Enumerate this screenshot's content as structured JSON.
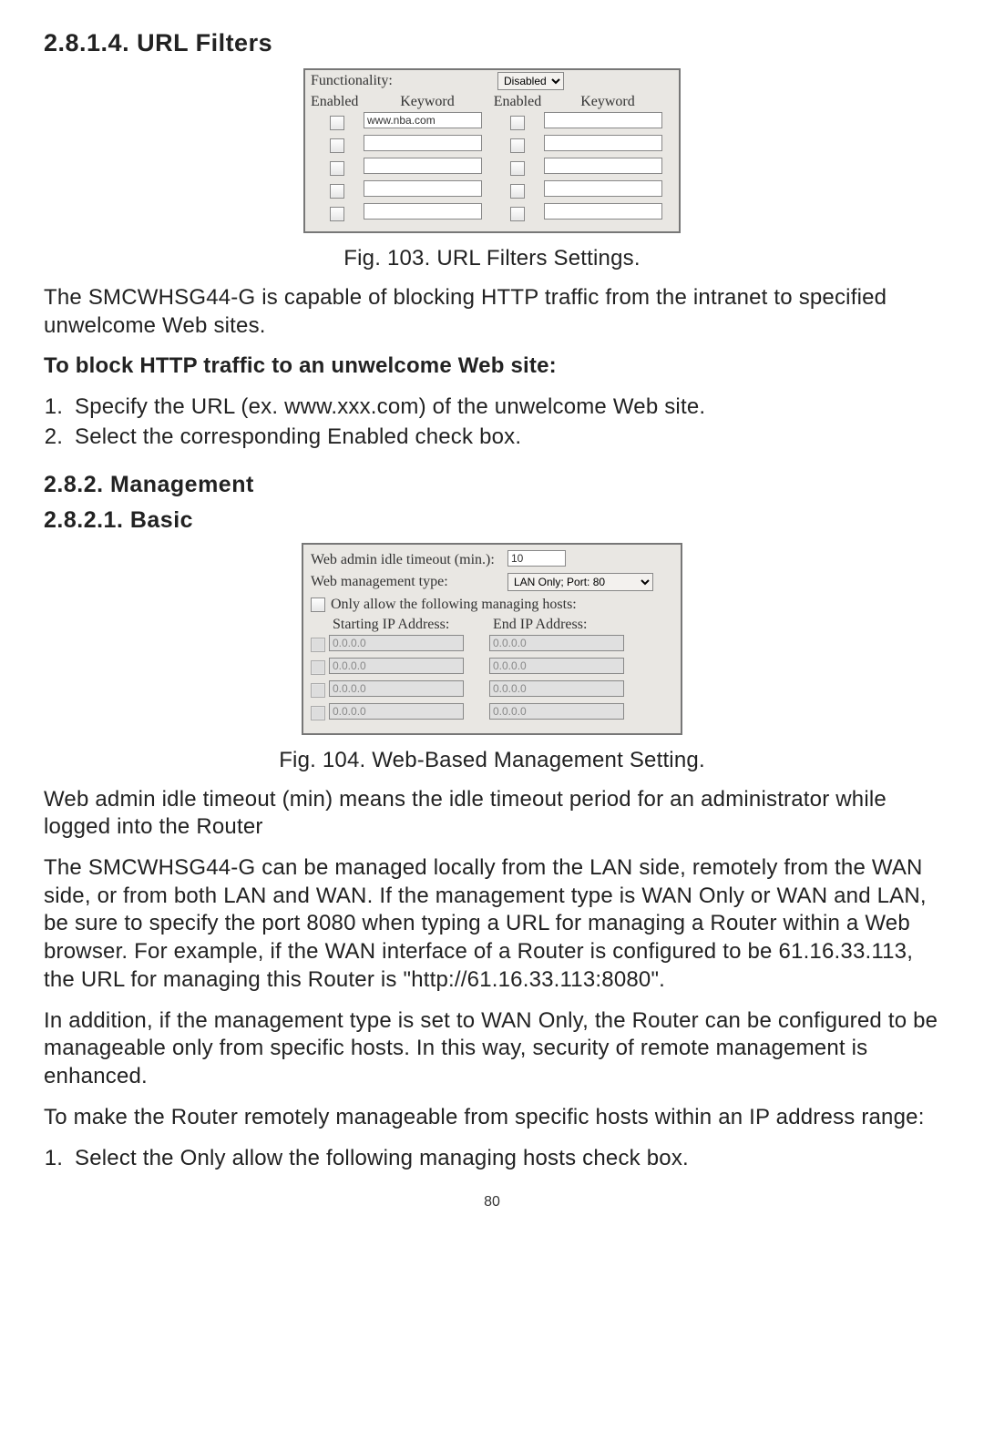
{
  "h_url_filters": "2.8.1.4. URL Filters",
  "url_filters_figure": {
    "functionality_label": "Functionality:",
    "functionality_value": "Disabled",
    "col_enabled": "Enabled",
    "col_keyword": "Keyword",
    "rows": [
      {
        "left_enabled": false,
        "left_keyword": "www.nba.com",
        "right_enabled": false,
        "right_keyword": ""
      },
      {
        "left_enabled": false,
        "left_keyword": "",
        "right_enabled": false,
        "right_keyword": ""
      },
      {
        "left_enabled": false,
        "left_keyword": "",
        "right_enabled": false,
        "right_keyword": ""
      },
      {
        "left_enabled": false,
        "left_keyword": "",
        "right_enabled": false,
        "right_keyword": ""
      },
      {
        "left_enabled": false,
        "left_keyword": "",
        "right_enabled": false,
        "right_keyword": ""
      }
    ]
  },
  "caption_103": "Fig. 103. URL Filters Settings.",
  "para_urlf_desc": "The SMCWHSG44-G is capable of blocking HTTP traffic from the intranet to specified unwelcome Web sites.",
  "para_urlf_bold": "To block HTTP traffic to an unwelcome Web site:",
  "steps_urlf": [
    "Specify the URL (ex. www.xxx.com) of the unwelcome Web site.",
    "Select the corresponding Enabled check box."
  ],
  "h_management": "2.8.2. Management",
  "h_basic": "2.8.2.1. Basic",
  "mgmt_figure": {
    "idle_label": "Web admin idle timeout (min.):",
    "idle_value": "10",
    "type_label": "Web management type:",
    "type_value": "LAN Only; Port: 80",
    "only_allow_label": "Only allow the following managing hosts:",
    "only_allow_checked": false,
    "start_ip_label": "Starting IP Address:",
    "end_ip_label": "End IP Address:",
    "rows": [
      {
        "enabled": false,
        "start": "0.0.0.0",
        "end": "0.0.0.0"
      },
      {
        "enabled": false,
        "start": "0.0.0.0",
        "end": "0.0.0.0"
      },
      {
        "enabled": false,
        "start": "0.0.0.0",
        "end": "0.0.0.0"
      },
      {
        "enabled": false,
        "start": "0.0.0.0",
        "end": "0.0.0.0"
      }
    ]
  },
  "caption_104": "Fig. 104. Web-Based Management Setting.",
  "para_mgmt_1": "Web admin idle timeout (min) means the idle timeout period for an administrator while logged into the Router",
  "para_mgmt_2": "The SMCWHSG44-G can be managed locally from the LAN side, remotely from the WAN side, or from both LAN and WAN. If the management type is WAN Only or WAN and LAN, be sure to specify the port 8080 when typing a URL for managing a Router within a Web browser. For example, if the WAN interface of a Router is configured to be 61.16.33.113, the URL for managing this Router is \"http://61.16.33.113:8080\".",
  "para_mgmt_3": "In addition, if the management type is set to WAN Only, the Router can be configured to be manageable only from specific hosts. In this way, security of remote management is enhanced.",
  "para_mgmt_4": "To make the Router remotely manageable from specific hosts within an IP address range:",
  "steps_mgmt": [
    "Select the Only allow the following managing hosts check box."
  ],
  "page_number": "80"
}
